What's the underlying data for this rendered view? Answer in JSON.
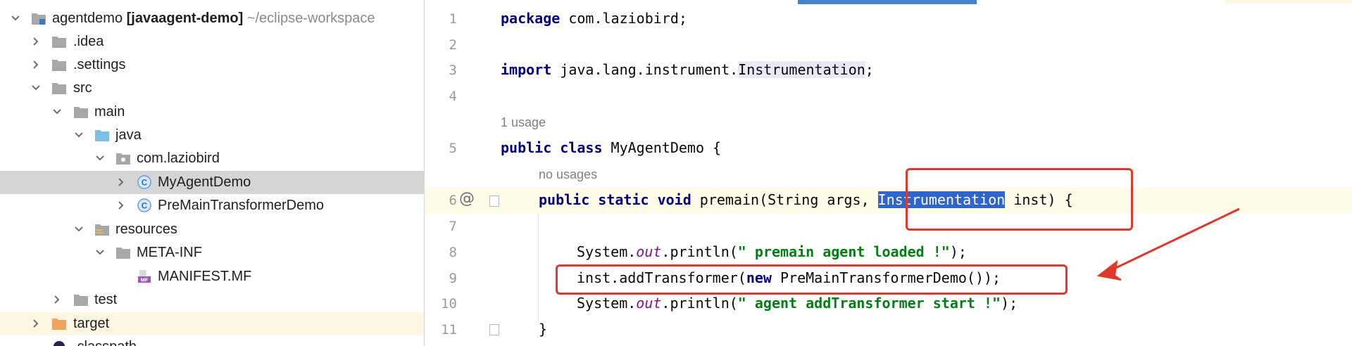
{
  "project_tree": {
    "root": {
      "name": "agentdemo",
      "module": "[javaagent-demo]",
      "path": "~/eclipse-workspace"
    },
    "items": [
      {
        "label": ".idea"
      },
      {
        "label": ".settings"
      },
      {
        "label": "src"
      },
      {
        "label": "main"
      },
      {
        "label": "java"
      },
      {
        "label": "com.laziobird"
      },
      {
        "label": "MyAgentDemo"
      },
      {
        "label": "PreMainTransformerDemo"
      },
      {
        "label": "resources"
      },
      {
        "label": "META-INF"
      },
      {
        "label": "MANIFEST.MF",
        "icon_text": "MF"
      },
      {
        "label": "test"
      },
      {
        "label": "target"
      },
      {
        "label": ".classpath"
      }
    ],
    "class_icon_letter": "C"
  },
  "editor": {
    "line_numbers": [
      "1",
      "2",
      "3",
      "4",
      "5",
      "6",
      "7",
      "8",
      "9",
      "10",
      "11"
    ],
    "gutter_marker": "@",
    "usage_hint_1": "1 usage",
    "usage_hint_2": "no usages",
    "code": {
      "l1_kw": "package",
      "l1_rest": " com.laziobird;",
      "l3_kw": "import",
      "l3_pre": " java.lang.instrument.",
      "l3_type": "Instrumentation",
      "l3_end": ";",
      "l5_kw": "public class",
      "l5_rest": " MyAgentDemo {",
      "l6_kw": "public static void",
      "l6_mid": " premain(String args, ",
      "l6_sel": "Instrumentation",
      "l6_end": " inst) {",
      "l8_pre": "System.",
      "l8_out": "out",
      "l8_call": ".println(",
      "l8_str": "\" premain agent loaded !\"",
      "l8_end": ");",
      "l9_pre": "inst.addTransformer(",
      "l9_kw": "new",
      "l9_end": " PreMainTransformerDemo());",
      "l10_pre": "System.",
      "l10_out": "out",
      "l10_call": ".println(",
      "l10_str": "\" agent addTransformer start !\"",
      "l10_end": ");",
      "l11": "}"
    }
  },
  "colors": {
    "selection": "#d5d5d5",
    "keyword": "#0033b3",
    "string": "#067d17",
    "annotation_red": "#e0382c",
    "accent_blue": "#4a82c7"
  }
}
